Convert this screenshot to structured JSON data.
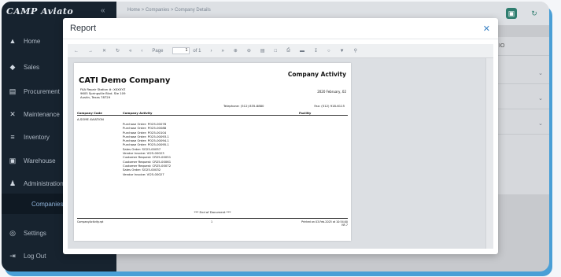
{
  "app": {
    "brand": "CAMP Aviato",
    "collapse_icon": "«",
    "breadcrumb": "Home  >  Companies  >  Company Details"
  },
  "sidebar": {
    "items": [
      {
        "icon": "▲",
        "label": "Home"
      },
      {
        "icon": "◆",
        "label": "Sales"
      },
      {
        "icon": "▤",
        "label": "Procurement"
      },
      {
        "icon": "✕",
        "label": "Maintenance"
      },
      {
        "icon": "≡",
        "label": "Inventory"
      },
      {
        "icon": "▣",
        "label": "Warehouse"
      },
      {
        "icon": "♟",
        "label": "Administration"
      },
      {
        "icon": "",
        "label": "Companies"
      },
      {
        "icon": "◎",
        "label": "Settings"
      },
      {
        "icon": "⇥",
        "label": "Log Out"
      }
    ]
  },
  "background_panel": {
    "label": "IO"
  },
  "modal": {
    "title": "Report",
    "close_icon": "✕"
  },
  "toolbar": {
    "page_label": "Page",
    "page_value": "1",
    "of_label": "of 1"
  },
  "report": {
    "company": "CATI Demo Company",
    "title": "Company Activity",
    "date": "2020 February, 02",
    "address_lines": [
      "FAA Repair Station #: XXXXYZ",
      "9605 Springville Blvd. Ste 109",
      "Austin, Texas  78729"
    ],
    "telephone": "Telephone:   (512) 835-8880",
    "fax": "Fax:   (512) 918-6115",
    "col_code": "Company Code",
    "col_activity": "Company Activity",
    "col_facility": "Facility",
    "company_code": "A-SOME AVIATION",
    "activities": [
      "Purchase Order:  PO25-00078",
      "Purchase Order:  PO25-00088",
      "Purchase Order:  PO25-00104",
      "Purchase Order:  PO25-00093.1",
      "Purchase Order:  PO25-00094.1",
      "Purchase Order:  PO25-00095.1",
      "Sales Order:  SO25-00057",
      "Vendor Invoice:  VI25-00023",
      "Customer Request:  CR25-00051",
      "Customer Request:  CR25-00061",
      "Customer Request:  CR25-00072",
      "Sales Order:  SO25-00032",
      "Vendor Invoice:  VI25-00027"
    ],
    "end_text": "*** End of Document ***",
    "footer_left": "CompanyActivity.rpt",
    "footer_center": "1",
    "footer_right_1": "Printed on 03-Feb-2025 at 10:54:00",
    "footer_right_2": "NF-7"
  }
}
